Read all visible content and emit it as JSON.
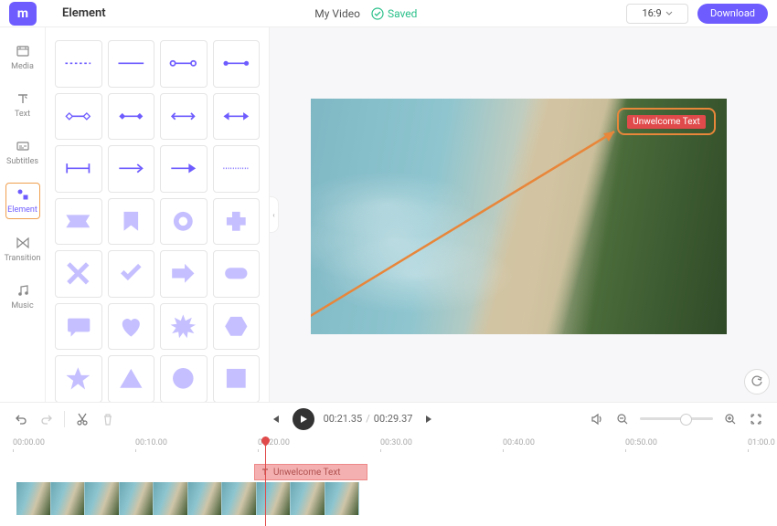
{
  "header": {
    "panel_title": "Element",
    "project_name": "My Video",
    "saved_label": "Saved",
    "aspect_ratio": "16:9",
    "download_label": "Download"
  },
  "nav": {
    "items": [
      {
        "label": "Media",
        "icon": "media"
      },
      {
        "label": "Text",
        "icon": "text"
      },
      {
        "label": "Subtitles",
        "icon": "subtitles"
      },
      {
        "label": "Element",
        "icon": "element",
        "active": true
      },
      {
        "label": "Transition",
        "icon": "transition"
      },
      {
        "label": "Music",
        "icon": "music"
      }
    ]
  },
  "canvas": {
    "overlay_label": "Unwelcome Text"
  },
  "playback": {
    "current": "00:21.35",
    "duration": "00:29.37"
  },
  "timeline": {
    "ticks": [
      "00:00.00",
      "00:10.00",
      "00:20.00",
      "00:30.00",
      "00:40.00",
      "00:50.00",
      "01:00.0"
    ],
    "text_clip_label": "Unwelcome Text"
  }
}
